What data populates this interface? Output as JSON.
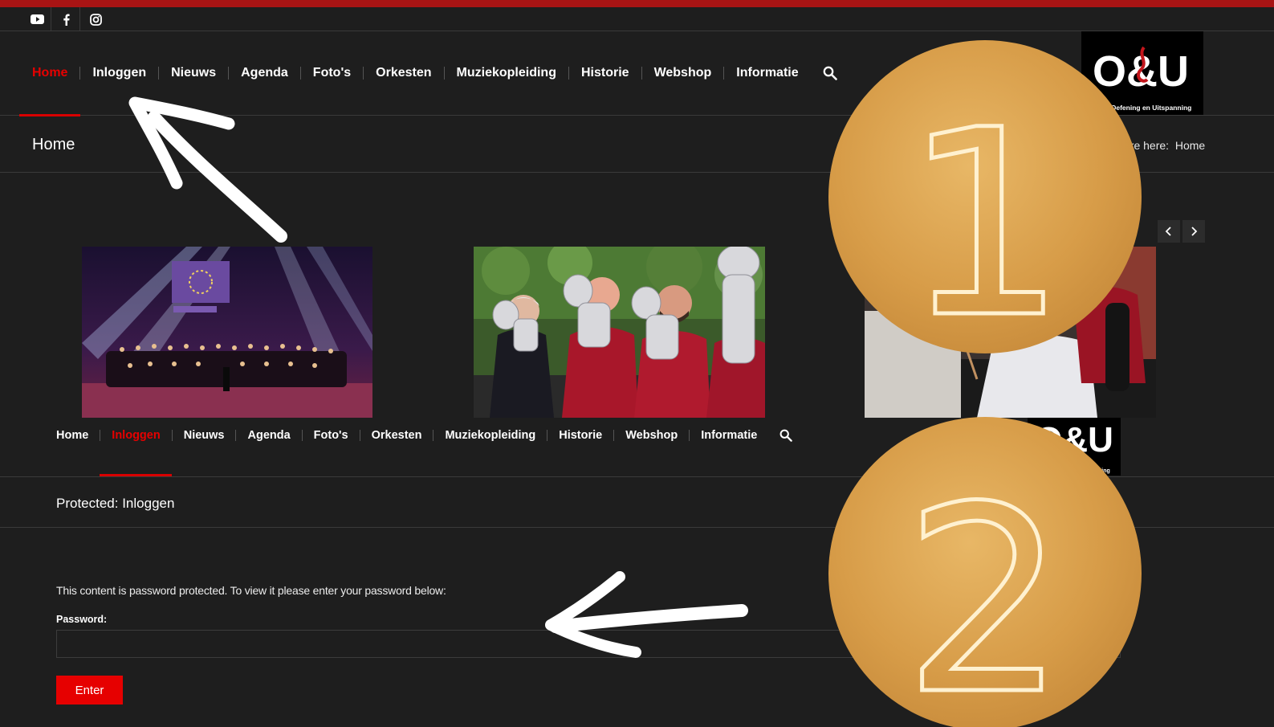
{
  "screen1": {
    "nav": [
      {
        "label": "Home",
        "active": true
      },
      {
        "label": "Inloggen",
        "active": false
      },
      {
        "label": "Nieuws",
        "active": false
      },
      {
        "label": "Agenda",
        "active": false
      },
      {
        "label": "Foto's",
        "active": false
      },
      {
        "label": "Orkesten",
        "active": false
      },
      {
        "label": "Muziekopleiding",
        "active": false
      },
      {
        "label": "Historie",
        "active": false
      },
      {
        "label": "Webshop",
        "active": false
      },
      {
        "label": "Informatie",
        "active": false
      }
    ],
    "page_title": "Home",
    "breadcrumb_prefix": "are here:",
    "breadcrumb_current": "Home",
    "logo_text": "O&U",
    "logo_subtext": "nd Oefening en Uitspanning"
  },
  "screen2": {
    "nav": [
      {
        "label": "Home",
        "active": false
      },
      {
        "label": "Inloggen",
        "active": true
      },
      {
        "label": "Nieuws",
        "active": false
      },
      {
        "label": "Agenda",
        "active": false
      },
      {
        "label": "Foto's",
        "active": false
      },
      {
        "label": "Orkesten",
        "active": false
      },
      {
        "label": "Muziekopleiding",
        "active": false
      },
      {
        "label": "Historie",
        "active": false
      },
      {
        "label": "Webshop",
        "active": false
      },
      {
        "label": "Informatie",
        "active": false
      }
    ],
    "page_title": "Protected: Inloggen",
    "protect_message": "This content is password protected. To view it please enter your password below:",
    "password_label": "Password:",
    "password_value": "",
    "enter_label": "Enter",
    "logo_subtext": "ning"
  },
  "coins": {
    "first": "1",
    "second": "2"
  },
  "icons": {
    "social": [
      "youtube-icon",
      "facebook-icon",
      "instagram-icon"
    ],
    "search": "search-icon",
    "slider": [
      "chevron-left-icon",
      "chevron-right-icon"
    ]
  },
  "colors": {
    "background": "#1e1e1e",
    "top_bar": "#a81414",
    "accent_red": "#e60000",
    "coin_gold": "#d9a14f"
  }
}
